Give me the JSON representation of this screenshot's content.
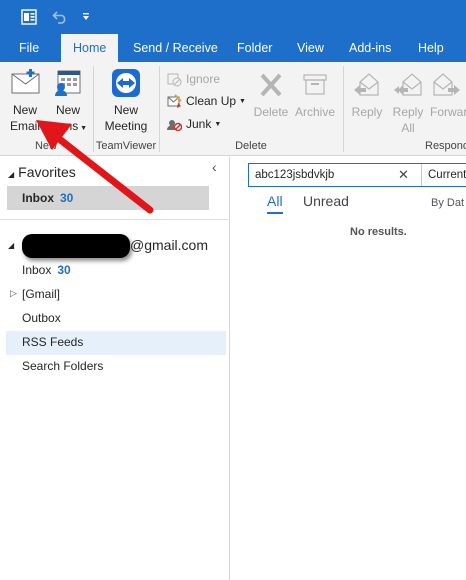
{
  "tabs": [
    {
      "label": "File"
    },
    {
      "label": "Home"
    },
    {
      "label": "Send / Receive"
    },
    {
      "label": "Folder"
    },
    {
      "label": "View"
    },
    {
      "label": "Add-ins"
    },
    {
      "label": "Help"
    }
  ],
  "ribbon": {
    "new_email": {
      "line1": "New",
      "line2": "Email"
    },
    "new_items": {
      "line1": "New",
      "line2": "Items"
    },
    "new_meeting": {
      "line1": "New",
      "line2": "Meeting"
    },
    "ignore": "Ignore",
    "clean_up": "Clean Up",
    "junk": "Junk",
    "delete": "Delete",
    "archive": "Archive",
    "reply": "Reply",
    "reply_all": {
      "line1": "Reply",
      "line2": "All"
    },
    "forward": "Forwar",
    "groups": {
      "new": "New",
      "teamviewer": "TeamViewer",
      "delete": "Delete",
      "respond": "Respond"
    }
  },
  "nav": {
    "favorites_label": "Favorites",
    "collapse_glyph": "‹",
    "fav_inbox": {
      "label": "Inbox",
      "count": "30"
    },
    "account_suffix": "@gmail.com",
    "inbox": {
      "label": "Inbox",
      "count": "30"
    },
    "gmail": "[Gmail]",
    "outbox": "Outbox",
    "rss": "RSS Feeds",
    "search_folders": "Search Folders"
  },
  "search": {
    "value": "abc123jsbdvkjb",
    "clear_glyph": "✕",
    "scope": "Current"
  },
  "list": {
    "filter_all": "All",
    "filter_unread": "Unread",
    "sort_by": "By Dat",
    "no_results": "No results."
  },
  "colors": {
    "accent": "#1e6fc9",
    "ribbon_bg": "#f3f3f3",
    "arrow": "#e0161b"
  }
}
